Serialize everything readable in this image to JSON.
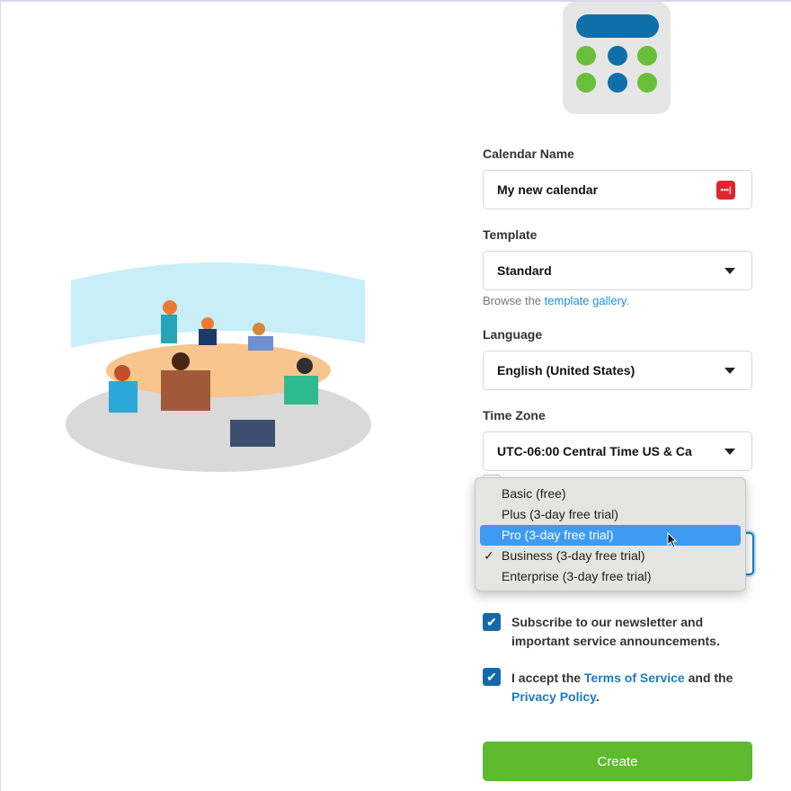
{
  "colors": {
    "accent": "#1a8fd6",
    "primary_button": "#5fba2e",
    "checkbox": "#1569a8",
    "selected_option": "#3d9bf2"
  },
  "form": {
    "calendar_name": {
      "label": "Calendar Name",
      "value": "My new calendar",
      "icon": "password-manager-icon"
    },
    "template": {
      "label": "Template",
      "value": "Standard",
      "help_prefix": "Browse the ",
      "help_link": "template gallery",
      "help_suffix": "."
    },
    "language": {
      "label": "Language",
      "value": "English (United States)"
    },
    "time_zone": {
      "label": "Time Zone",
      "value": "UTC-06:00 Central Time US & Ca"
    },
    "plan_dropdown": {
      "options": [
        "Basic (free)",
        "Plus (3-day free trial)",
        "Pro (3-day free trial)",
        "Business (3-day free trial)",
        "Enterprise (3-day free trial)"
      ],
      "highlighted": "Pro (3-day free trial)",
      "checked": "Business (3-day free trial)"
    },
    "newsletter": {
      "checked": true,
      "text": "Subscribe to our newsletter and important service announcements."
    },
    "terms": {
      "checked": true,
      "prefix": "I accept the ",
      "tos": "Terms of Service",
      "middle": " and the ",
      "privacy": "Privacy Policy",
      "suffix": "."
    },
    "create_label": "Create"
  }
}
